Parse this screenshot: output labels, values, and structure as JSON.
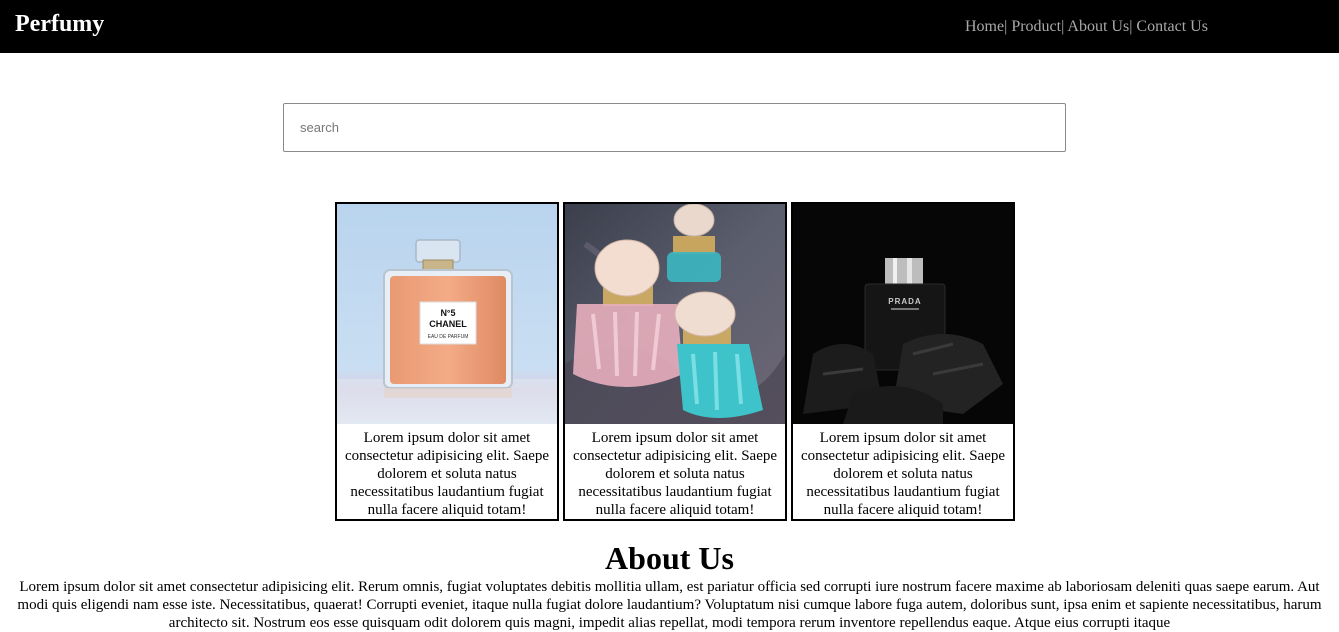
{
  "header": {
    "brand": "Perfumy",
    "nav": [
      {
        "label": "Home"
      },
      {
        "label": "Product"
      },
      {
        "label": "About Us"
      },
      {
        "label": "Contact Us"
      }
    ],
    "separator": "|"
  },
  "search": {
    "placeholder": "search",
    "value": ""
  },
  "products": [
    {
      "image": "chanel-no5-bottle-image",
      "brand_on_bottle": "N°5 CHANEL",
      "bottle_subtext": "EAU DE PARFUM",
      "description": "Lorem ipsum dolor sit amet consectetur adipisicing elit. Saepe dolorem et soluta natus necessitatibus laudantium fugiat nulla facere aliquid totam!"
    },
    {
      "image": "miu-miu-bottles-image",
      "description": "Lorem ipsum dolor sit amet consectetur adipisicing elit. Saepe dolorem et soluta natus necessitatibus laudantium fugiat nulla facere aliquid totam!"
    },
    {
      "image": "prada-bottle-image",
      "brand_on_bottle": "PRADA",
      "description": "Lorem ipsum dolor sit amet consectetur adipisicing elit. Saepe dolorem et soluta natus necessitatibus laudantium fugiat nulla facere aliquid totam!"
    }
  ],
  "about": {
    "title": "About Us",
    "text": "Lorem ipsum dolor sit amet consectetur adipisicing elit. Rerum omnis, fugiat voluptates debitis mollitia ullam, est pariatur officia sed corrupti iure nostrum facere maxime ab laboriosam deleniti quas saepe earum. Aut modi quis eligendi nam esse iste. Necessitatibus, quaerat! Corrupti eveniet, itaque nulla fugiat dolore laudantium? Voluptatum nisi cumque labore fuga autem, doloribus sunt, ipsa enim et sapiente necessitatibus, harum architecto sit. Nostrum eos esse quisquam odit dolorem quis magni, impedit alias repellat, modi tempora rerum inventore repellendus eaque. Atque eius corrupti itaque"
  },
  "colors": {
    "header_bg": "#000000",
    "brand_text": "#ffffff",
    "nav_text": "#a9a9a9"
  }
}
